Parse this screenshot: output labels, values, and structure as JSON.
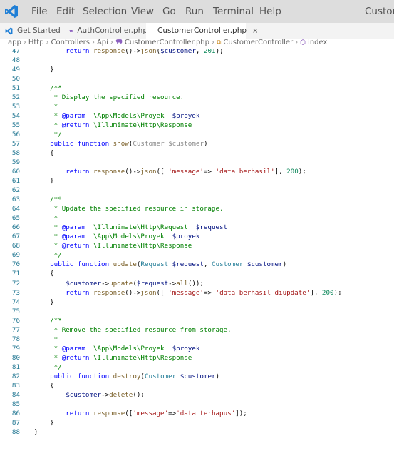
{
  "menu": {
    "items": [
      "File",
      "Edit",
      "Selection",
      "View",
      "Go",
      "Run",
      "Terminal",
      "Help"
    ],
    "title": "Custom"
  },
  "tabs": [
    {
      "label": "Get Started",
      "icon": "vscode-icon"
    },
    {
      "label": "AuthController.php",
      "icon": "php-icon"
    },
    {
      "label": "CustomerController.php",
      "icon": "php-icon",
      "close": "×"
    }
  ],
  "breadcrumb": [
    "app",
    "Http",
    "Controllers",
    "Api",
    "CustomerController.php",
    "CustomerController",
    "index"
  ],
  "colors": {
    "menubar": "#dddddd",
    "tabbar": "#f3f3f3",
    "line_number": "#237893",
    "comment": "#008000",
    "keyword": "#0000ff",
    "variable": "#001080",
    "string": "#a31515",
    "number": "#098658",
    "function": "#795e26",
    "type": "#267f99"
  },
  "code": [
    {
      "n": "47",
      "t": [
        [
          "        return ",
          "k"
        ],
        [
          "response",
          "f"
        ],
        [
          "()->",
          "d"
        ],
        [
          "json",
          "f"
        ],
        [
          "(",
          "d"
        ],
        [
          "$customer",
          "v"
        ],
        [
          ", ",
          "d"
        ],
        [
          "201",
          "n"
        ],
        [
          ");",
          "d"
        ]
      ]
    },
    {
      "n": "48",
      "t": []
    },
    {
      "n": "49",
      "t": [
        [
          "    }",
          "d"
        ]
      ]
    },
    {
      "n": "50",
      "t": []
    },
    {
      "n": "51",
      "t": [
        [
          "    /**",
          "c"
        ]
      ]
    },
    {
      "n": "52",
      "t": [
        [
          "     * Display the specified resource.",
          "c"
        ]
      ]
    },
    {
      "n": "53",
      "t": [
        [
          "     *",
          "c"
        ]
      ]
    },
    {
      "n": "54",
      "t": [
        [
          "     * ",
          "c"
        ],
        [
          "@param",
          "k"
        ],
        [
          "  \\App\\Models\\Proyek  ",
          "c"
        ],
        [
          "$proyek",
          "v"
        ]
      ]
    },
    {
      "n": "55",
      "t": [
        [
          "     * ",
          "c"
        ],
        [
          "@return",
          "k"
        ],
        [
          " \\Illuminate\\Http\\Response",
          "c"
        ]
      ]
    },
    {
      "n": "56",
      "t": [
        [
          "     */",
          "c"
        ]
      ]
    },
    {
      "n": "57",
      "t": [
        [
          "    public ",
          "k"
        ],
        [
          "function ",
          "k"
        ],
        [
          "show",
          "f"
        ],
        [
          "(",
          "d"
        ],
        [
          "Customer ",
          "g"
        ],
        [
          "$customer",
          "g"
        ],
        [
          ")",
          "d"
        ]
      ]
    },
    {
      "n": "58",
      "t": [
        [
          "    {",
          "d"
        ]
      ]
    },
    {
      "n": "59",
      "t": []
    },
    {
      "n": "60",
      "t": [
        [
          "        return ",
          "k"
        ],
        [
          "response",
          "f"
        ],
        [
          "()->",
          "d"
        ],
        [
          "json",
          "f"
        ],
        [
          "([ ",
          "d"
        ],
        [
          "'message'",
          "s"
        ],
        [
          "=> ",
          "d"
        ],
        [
          "'data berhasil'",
          "s"
        ],
        [
          "], ",
          "d"
        ],
        [
          "200",
          "n"
        ],
        [
          ");",
          "d"
        ]
      ]
    },
    {
      "n": "61",
      "t": [
        [
          "    }",
          "d"
        ]
      ]
    },
    {
      "n": "62",
      "t": []
    },
    {
      "n": "63",
      "t": [
        [
          "    /**",
          "c"
        ]
      ]
    },
    {
      "n": "64",
      "t": [
        [
          "     * Update the specified resource in storage.",
          "c"
        ]
      ]
    },
    {
      "n": "65",
      "t": [
        [
          "     *",
          "c"
        ]
      ]
    },
    {
      "n": "66",
      "t": [
        [
          "     * ",
          "c"
        ],
        [
          "@param",
          "k"
        ],
        [
          "  \\Illuminate\\Http\\Request  ",
          "c"
        ],
        [
          "$request",
          "v"
        ]
      ]
    },
    {
      "n": "67",
      "t": [
        [
          "     * ",
          "c"
        ],
        [
          "@param",
          "k"
        ],
        [
          "  \\App\\Models\\Proyek  ",
          "c"
        ],
        [
          "$proyek",
          "v"
        ]
      ]
    },
    {
      "n": "68",
      "t": [
        [
          "     * ",
          "c"
        ],
        [
          "@return",
          "k"
        ],
        [
          " \\Illuminate\\Http\\Response",
          "c"
        ]
      ]
    },
    {
      "n": "69",
      "t": [
        [
          "     */",
          "c"
        ]
      ]
    },
    {
      "n": "70",
      "t": [
        [
          "    public ",
          "k"
        ],
        [
          "function ",
          "k"
        ],
        [
          "update",
          "f"
        ],
        [
          "(",
          "d"
        ],
        [
          "Request ",
          "y"
        ],
        [
          "$request",
          "v"
        ],
        [
          ", ",
          "d"
        ],
        [
          "Customer ",
          "y"
        ],
        [
          "$customer",
          "v"
        ],
        [
          ")",
          "d"
        ]
      ]
    },
    {
      "n": "71",
      "t": [
        [
          "    {",
          "d"
        ]
      ]
    },
    {
      "n": "72",
      "t": [
        [
          "        ",
          "d"
        ],
        [
          "$customer",
          "v"
        ],
        [
          "->",
          "d"
        ],
        [
          "update",
          "f"
        ],
        [
          "(",
          "d"
        ],
        [
          "$request",
          "v"
        ],
        [
          "->",
          "d"
        ],
        [
          "all",
          "f"
        ],
        [
          "());",
          "d"
        ]
      ]
    },
    {
      "n": "73",
      "t": [
        [
          "        return ",
          "k"
        ],
        [
          "response",
          "f"
        ],
        [
          "()->",
          "d"
        ],
        [
          "json",
          "f"
        ],
        [
          "([ ",
          "d"
        ],
        [
          "'message'",
          "s"
        ],
        [
          "=> ",
          "d"
        ],
        [
          "'data berhasil diupdate'",
          "s"
        ],
        [
          "], ",
          "d"
        ],
        [
          "200",
          "n"
        ],
        [
          ");",
          "d"
        ]
      ]
    },
    {
      "n": "74",
      "t": [
        [
          "    }",
          "d"
        ]
      ]
    },
    {
      "n": "75",
      "t": []
    },
    {
      "n": "76",
      "t": [
        [
          "    /**",
          "c"
        ]
      ]
    },
    {
      "n": "77",
      "t": [
        [
          "     * Remove the specified resource from storage.",
          "c"
        ]
      ]
    },
    {
      "n": "78",
      "t": [
        [
          "     *",
          "c"
        ]
      ]
    },
    {
      "n": "79",
      "t": [
        [
          "     * ",
          "c"
        ],
        [
          "@param",
          "k"
        ],
        [
          "  \\App\\Models\\Proyek  ",
          "c"
        ],
        [
          "$proyek",
          "v"
        ]
      ]
    },
    {
      "n": "80",
      "t": [
        [
          "     * ",
          "c"
        ],
        [
          "@return",
          "k"
        ],
        [
          " \\Illuminate\\Http\\Response",
          "c"
        ]
      ]
    },
    {
      "n": "81",
      "t": [
        [
          "     */",
          "c"
        ]
      ]
    },
    {
      "n": "82",
      "t": [
        [
          "    public ",
          "k"
        ],
        [
          "function ",
          "k"
        ],
        [
          "destroy",
          "f"
        ],
        [
          "(",
          "d"
        ],
        [
          "Customer ",
          "y"
        ],
        [
          "$customer",
          "v"
        ],
        [
          ")",
          "d"
        ]
      ]
    },
    {
      "n": "83",
      "t": [
        [
          "    {",
          "d"
        ]
      ]
    },
    {
      "n": "84",
      "t": [
        [
          "        ",
          "d"
        ],
        [
          "$customer",
          "v"
        ],
        [
          "->",
          "d"
        ],
        [
          "delete",
          "f"
        ],
        [
          "();",
          "d"
        ]
      ]
    },
    {
      "n": "85",
      "t": []
    },
    {
      "n": "86",
      "t": [
        [
          "        return ",
          "k"
        ],
        [
          "response",
          "f"
        ],
        [
          "([",
          "d"
        ],
        [
          "'message'",
          "s"
        ],
        [
          "=>",
          "d"
        ],
        [
          "'data terhapus'",
          "s"
        ],
        [
          "]);",
          "d"
        ]
      ]
    },
    {
      "n": "87",
      "t": [
        [
          "    }",
          "d"
        ]
      ]
    },
    {
      "n": "88",
      "t": [
        [
          "}",
          "d"
        ]
      ]
    }
  ]
}
